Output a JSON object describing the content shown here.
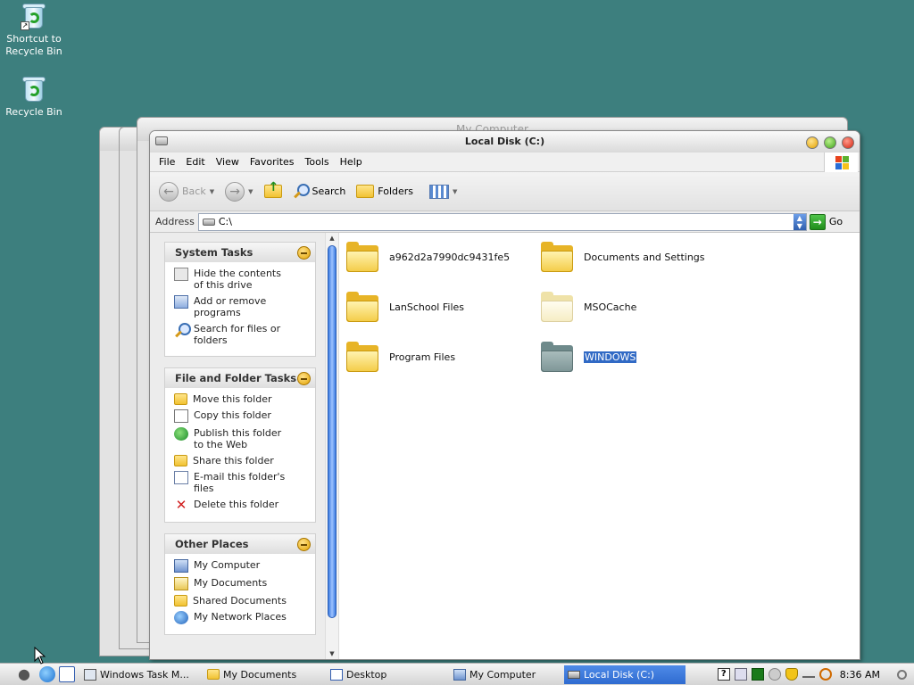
{
  "desktop": {
    "icons": [
      {
        "label_line1": "Shortcut to",
        "label_line2": "Recycle Bin"
      },
      {
        "label_line1": "Recycle Bin",
        "label_line2": ""
      }
    ],
    "background_color": "#3d7f7e"
  },
  "background_windows": {
    "title": "My Computer"
  },
  "window": {
    "title": "Local Disk (C:)",
    "menu": [
      "File",
      "Edit",
      "View",
      "Favorites",
      "Tools",
      "Help"
    ],
    "toolbar": {
      "back": "Back",
      "search": "Search",
      "folders": "Folders"
    },
    "address": {
      "label": "Address",
      "value": "C:\\",
      "go": "Go"
    }
  },
  "taskpane": {
    "system_tasks": {
      "title": "System Tasks",
      "items": [
        {
          "label": "Hide the contents of this drive",
          "icon": "hide-contents-icon"
        },
        {
          "label": "Add or remove programs",
          "icon": "add-remove-programs-icon"
        },
        {
          "label": "Search for files or folders",
          "icon": "search-icon"
        }
      ]
    },
    "file_folder_tasks": {
      "title": "File and Folder Tasks",
      "items": [
        {
          "label": "Move this folder",
          "icon": "move-folder-icon"
        },
        {
          "label": "Copy this folder",
          "icon": "copy-folder-icon"
        },
        {
          "label": "Publish this folder to the Web",
          "icon": "publish-web-icon"
        },
        {
          "label": "Share this folder",
          "icon": "share-folder-icon"
        },
        {
          "label": "E-mail this folder's files",
          "icon": "email-icon"
        },
        {
          "label": "Delete this folder",
          "icon": "delete-icon"
        }
      ]
    },
    "other_places": {
      "title": "Other Places",
      "items": [
        {
          "label": "My Computer",
          "icon": "my-computer-icon"
        },
        {
          "label": "My Documents",
          "icon": "my-documents-icon"
        },
        {
          "label": "Shared Documents",
          "icon": "shared-documents-icon"
        },
        {
          "label": "My Network Places",
          "icon": "network-places-icon"
        }
      ]
    }
  },
  "files": [
    {
      "name": "a962d2a7990dc9431fe5",
      "style": "normal"
    },
    {
      "name": "Documents and Settings",
      "style": "normal"
    },
    {
      "name": "LanSchool Files",
      "style": "normal"
    },
    {
      "name": "MSOCache",
      "style": "hidden"
    },
    {
      "name": "Program Files",
      "style": "normal"
    },
    {
      "name": "WINDOWS",
      "style": "selected"
    }
  ],
  "taskbar": {
    "buttons": [
      {
        "label": "Windows Task M...",
        "active": false
      },
      {
        "label": "My Documents",
        "active": false
      },
      {
        "label": "Desktop",
        "active": false
      },
      {
        "label": "My Computer",
        "active": false
      },
      {
        "label": "Local Disk (C:)",
        "active": true
      }
    ],
    "clock": "8:36 AM"
  }
}
